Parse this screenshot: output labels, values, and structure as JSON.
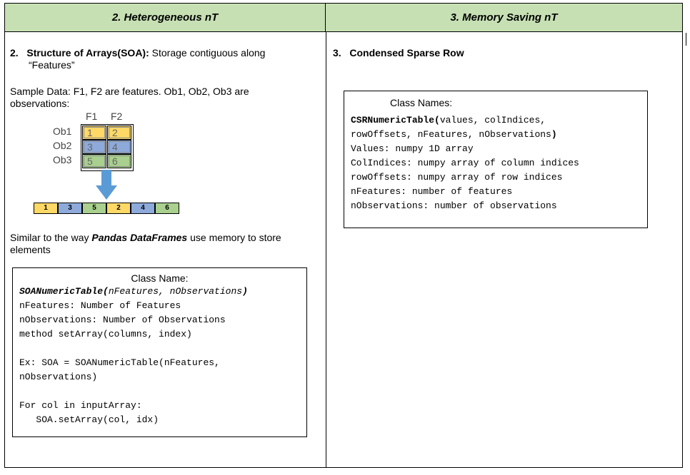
{
  "header": {
    "left": "2.  Heterogeneous nT",
    "right": "3.  Memory Saving nT"
  },
  "left": {
    "soa_title_num": "2.",
    "soa_title_bold": "Structure of Arrays(SOA):",
    "soa_title_rest": " Storage contiguous along",
    "soa_title_line2": "“Features”",
    "sample_line1": "Sample Data: F1, F2 are features. Ob1, Ob2, Ob3 are",
    "sample_line2": "observations:",
    "grid": {
      "col_headers": [
        "F1",
        "F2"
      ],
      "row_headers": [
        "Ob1",
        "Ob2",
        "Ob3"
      ],
      "cells": [
        [
          "1",
          "2"
        ],
        [
          "3",
          "4"
        ],
        [
          "5",
          "6"
        ]
      ],
      "row_colors": [
        "#ffd966",
        "#8eaadb",
        "#a9d08e"
      ]
    },
    "strip": [
      "1",
      "3",
      "5",
      "2",
      "4",
      "6"
    ],
    "similar_pre": "Similar to the way ",
    "similar_bold": "Pandas DataFrames",
    "similar_post": " use memory to store",
    "similar_line2": "elements",
    "codebox": {
      "title": "Class Name:",
      "line1_bold": "SOANumericTable(",
      "line1_rest": "nFeatures, nObservations",
      "line1_end": ")",
      "lines": [
        "nFeatures: Number of Features",
        "nObservations: Number of Observations",
        "method setArray(columns, index)",
        "",
        "Ex: SOA = SOANumericTable(nFeatures,",
        "nObservations)",
        "",
        "For col in inputArray:",
        "   SOA.setArray(col, idx)"
      ]
    }
  },
  "right": {
    "title_num": "3.",
    "title_bold": "Condensed Sparse Row",
    "codebox": {
      "title": "Class Names:",
      "line1_bold": "CSRNumericTable(",
      "line1_rest": "values, colIndices,",
      "line2_rest": "rowOffsets, nFeatures, nObservations",
      "line2_end": ")",
      "lines": [
        "Values: numpy 1D array",
        "ColIndices: numpy array of column indices",
        "rowOffsets: numpy array of row indices",
        "nFeatures: number of features",
        "nObservations: number of observations"
      ]
    }
  }
}
